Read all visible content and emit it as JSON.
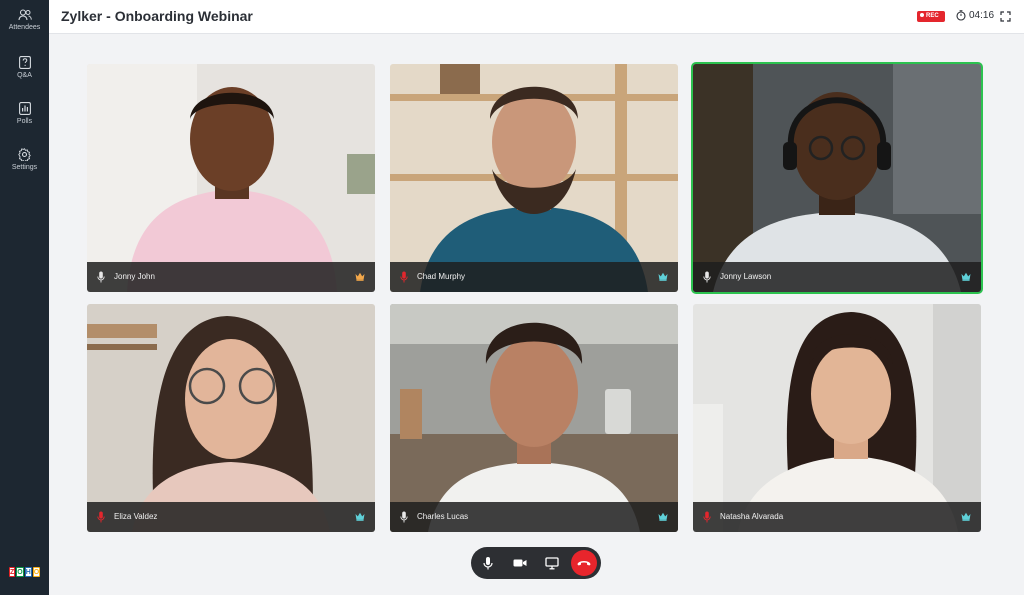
{
  "sidebar": {
    "items": [
      {
        "label": "Attendees",
        "icon": "users-icon"
      },
      {
        "label": "Q&A",
        "icon": "question-icon"
      },
      {
        "label": "Polls",
        "icon": "polls-icon"
      },
      {
        "label": "Settings",
        "icon": "gear-icon"
      }
    ],
    "logo_letters": [
      "Z",
      "O",
      "H",
      "O"
    ],
    "logo_colors": [
      "#e42527",
      "#089949",
      "#226db4",
      "#f9b21d"
    ]
  },
  "header": {
    "title": "Zylker - Onboarding Webinar",
    "rec_label": "REC",
    "timer": "04:16"
  },
  "colors": {
    "accent_active": "#2cc24f",
    "rec": "#e4262d",
    "end_call": "#e8252c",
    "mic_muted": "#e4262d",
    "crown_host": "#f2a74a",
    "crown_cohost": "#5fd0d8"
  },
  "participants": [
    {
      "name": "Jonny John",
      "mic": "on",
      "crown": "host",
      "active": false
    },
    {
      "name": "Chad Murphy",
      "mic": "muted",
      "crown": "cohost",
      "active": false
    },
    {
      "name": "Jonny Lawson",
      "mic": "on",
      "crown": "cohost",
      "active": true
    },
    {
      "name": "Eliza Valdez",
      "mic": "muted",
      "crown": "cohost",
      "active": false
    },
    {
      "name": "Charles Lucas",
      "mic": "on",
      "crown": "cohost",
      "active": false
    },
    {
      "name": "Natasha Alvarada",
      "mic": "muted",
      "crown": "cohost",
      "active": false
    }
  ],
  "controls": [
    "microphone-icon",
    "camera-icon",
    "screen-share-icon",
    "end-call-icon"
  ]
}
